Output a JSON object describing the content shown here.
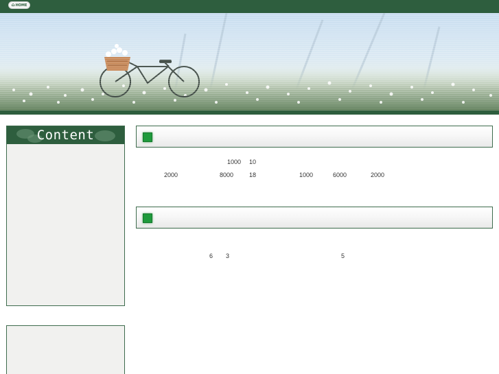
{
  "header": {
    "home_label": "HOME",
    "home_icon": "home-icon",
    "bar_color": "#2e5e3e"
  },
  "sidebar": {
    "content_title": "Content"
  },
  "main": {
    "section1": {
      "row1": [
        "1000",
        "10"
      ],
      "row2": [
        "2000",
        "8000",
        "18",
        "1000",
        "6000",
        "2000"
      ]
    },
    "section2": {
      "row1": [
        "6",
        "3",
        "5"
      ]
    },
    "accent_color": "#1f9a3c"
  }
}
